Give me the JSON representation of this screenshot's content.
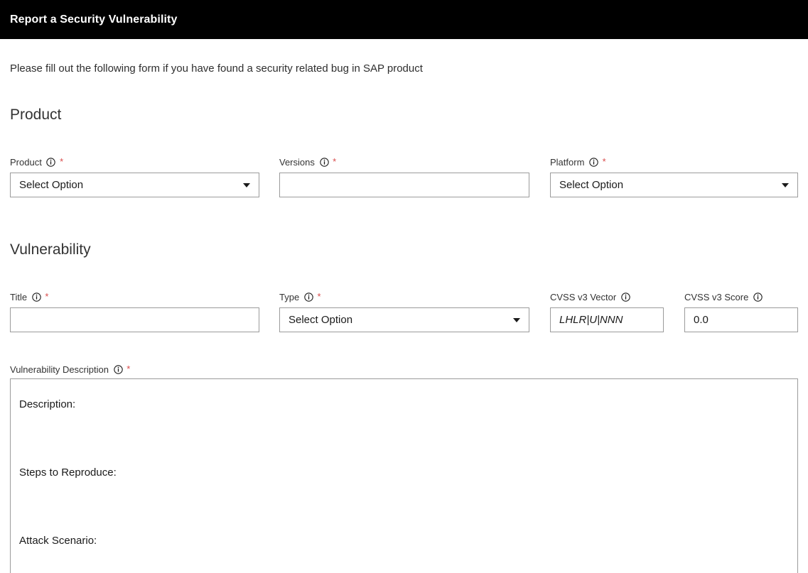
{
  "header": {
    "title": "Report a Security Vulnerability"
  },
  "intro": {
    "text": "Please fill out the following form if you have found a security related bug in SAP product"
  },
  "sections": {
    "product": {
      "heading": "Product",
      "fields": {
        "product": {
          "label": "Product",
          "info_icon": "info-circle-icon",
          "required_marker": "*",
          "control": "select",
          "value": "Select Option",
          "caret_icon": "chevron-down-icon"
        },
        "versions": {
          "label": "Versions",
          "info_icon": "info-circle-icon",
          "required_marker": "*",
          "control": "input",
          "value": "",
          "placeholder": ""
        },
        "platform": {
          "label": "Platform",
          "info_icon": "info-circle-icon",
          "required_marker": "*",
          "control": "select",
          "value": "Select Option",
          "caret_icon": "chevron-down-icon"
        }
      }
    },
    "vulnerability": {
      "heading": "Vulnerability",
      "fields": {
        "title": {
          "label": "Title",
          "info_icon": "info-circle-icon",
          "required_marker": "*",
          "control": "input",
          "value": "",
          "placeholder": ""
        },
        "type": {
          "label": "Type",
          "info_icon": "info-circle-icon",
          "required_marker": "*",
          "control": "select",
          "value": "Select Option",
          "caret_icon": "chevron-down-icon"
        },
        "cvss_vector": {
          "label": "CVSS v3 Vector",
          "info_icon": "info-circle-icon",
          "required_marker": "",
          "control": "input",
          "value": "LHLR|U|NNN"
        },
        "cvss_score": {
          "label": "CVSS v3 Score",
          "info_icon": "info-circle-icon",
          "required_marker": "",
          "control": "input",
          "value": "0.0"
        },
        "description": {
          "label": "Vulnerability Description",
          "info_icon": "info-circle-icon",
          "required_marker": "*",
          "control": "textarea",
          "value": "Description:\n\nSteps to Reproduce:\n\nAttack Scenario:\n\nAdditional Information:"
        }
      }
    }
  },
  "colors": {
    "header_background": "#000000",
    "header_text": "#ffffff",
    "required_star": "#d94c4c",
    "field_border": "#9b9b9b",
    "text": "#333333",
    "page_background": "#ffffff"
  }
}
